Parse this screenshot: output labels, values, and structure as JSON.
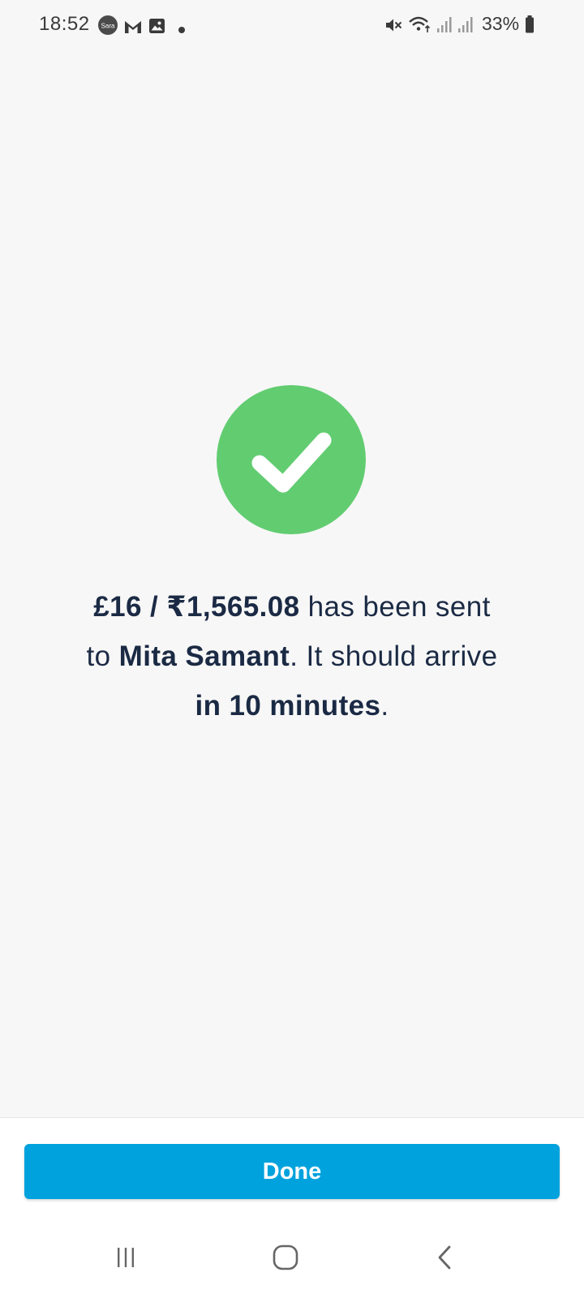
{
  "status_bar": {
    "time": "18:52",
    "notification_badge": "Sara",
    "battery": "33%",
    "icons": [
      "sara-badge-icon",
      "gmail-icon",
      "gallery-icon",
      "dot-icon",
      "mute-icon",
      "wifi-icon",
      "signal-icon",
      "signal-icon",
      "battery-icon"
    ]
  },
  "success": {
    "icon": "check-icon",
    "color": "#62cc71",
    "amount": "£16 / ₹1,565.08",
    "text_sent": " has been sent",
    "text_to": "to ",
    "recipient": "Mita Samant",
    "text_arrive": ". It should arrive",
    "eta": "in 10 minutes",
    "text_end": "."
  },
  "actions": {
    "done_label": "Done",
    "accent_color": "#00a2dd"
  },
  "nav_bar": {
    "icons": [
      "recent-apps-icon",
      "home-icon",
      "back-icon"
    ]
  }
}
